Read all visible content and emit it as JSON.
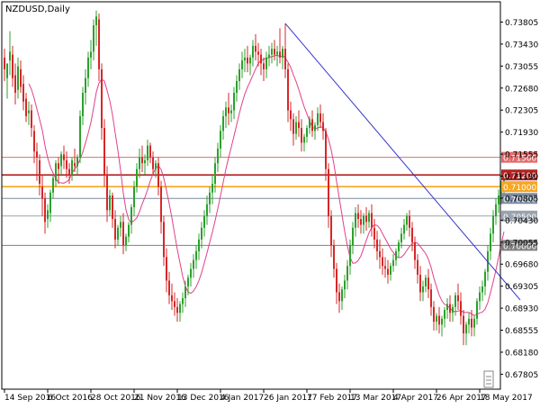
{
  "chart_data": {
    "type": "candlestick",
    "title": "NZDUSD,Daily",
    "price_axis": {
      "ylim": [
        0.6755,
        0.7415
      ],
      "tick_labels": [
        "0.73805",
        "0.73430",
        "0.73055",
        "0.72680",
        "0.72305",
        "0.71930",
        "0.71555",
        "0.71180",
        "0.70805",
        "0.70430",
        "0.70055",
        "0.69680",
        "0.69305",
        "0.68930",
        "0.68555",
        "0.68180",
        "0.67805"
      ]
    },
    "time_axis": {
      "labels": [
        "14 Sep 2016",
        "6 Oct 2016",
        "28 Oct 2016",
        "21 Nov 2016",
        "13 Dec 2016",
        "4 Jan 2017",
        "26 Jan 2017",
        "17 Feb 2017",
        "13 Mar 2017",
        "4 Apr 2017",
        "26 Apr 2017",
        "18 May 2017"
      ],
      "label_bar_index": [
        0,
        16,
        32,
        48,
        64,
        80,
        96,
        112,
        128,
        144,
        160,
        176
      ]
    },
    "horizontal_levels": [
      {
        "value": 0.715,
        "label": "0.71500",
        "color": "#e06b6b"
      },
      {
        "value": 0.712,
        "label": "0.71200",
        "color": "#b22222"
      },
      {
        "value": 0.71,
        "label": "0.71000",
        "color": "#f5a623"
      },
      {
        "value": 0.708,
        "label": "0.70800",
        "color": "#7a8aa0"
      },
      {
        "value": 0.705,
        "label": "0.70500",
        "color": "#9aa3ad"
      },
      {
        "value": 0.7,
        "label": "0.70000",
        "color": "#808080"
      }
    ],
    "trendline": {
      "from": {
        "bar": 104,
        "price": 0.7378
      },
      "to": {
        "bar": 191,
        "price": 0.6907
      },
      "color": "#3333cc"
    },
    "moving_average_color": "#e0408a",
    "bull_color": "#2ca02c",
    "bear_color": "#d62728",
    "candles": [
      [
        0.732,
        0.7335,
        0.73,
        0.728
      ],
      [
        0.7285,
        0.73,
        0.731,
        0.725
      ],
      [
        0.7315,
        0.7365,
        0.733,
        0.729
      ],
      [
        0.7325,
        0.734,
        0.7285,
        0.727
      ],
      [
        0.729,
        0.731,
        0.726,
        0.724
      ],
      [
        0.7265,
        0.732,
        0.7305,
        0.725
      ],
      [
        0.73,
        0.7315,
        0.727,
        0.726
      ],
      [
        0.7275,
        0.729,
        0.7245,
        0.723
      ],
      [
        0.725,
        0.726,
        0.722,
        0.721
      ],
      [
        0.7225,
        0.7245,
        0.723,
        0.7205
      ],
      [
        0.723,
        0.724,
        0.72,
        0.7185
      ],
      [
        0.7195,
        0.7205,
        0.716,
        0.714
      ],
      [
        0.716,
        0.7175,
        0.715,
        0.711
      ],
      [
        0.7145,
        0.7155,
        0.7105,
        0.7085
      ],
      [
        0.71,
        0.712,
        0.708,
        0.705
      ],
      [
        0.708,
        0.709,
        0.704,
        0.702
      ],
      [
        0.7045,
        0.707,
        0.706,
        0.703
      ],
      [
        0.7055,
        0.7095,
        0.709,
        0.704
      ],
      [
        0.709,
        0.712,
        0.7115,
        0.708
      ],
      [
        0.711,
        0.7145,
        0.714,
        0.71
      ],
      [
        0.714,
        0.715,
        0.713,
        0.7105
      ],
      [
        0.7135,
        0.716,
        0.7155,
        0.712
      ],
      [
        0.7155,
        0.717,
        0.7145,
        0.713
      ],
      [
        0.7145,
        0.716,
        0.713,
        0.7115
      ],
      [
        0.713,
        0.714,
        0.712,
        0.7105
      ],
      [
        0.712,
        0.715,
        0.7145,
        0.711
      ],
      [
        0.714,
        0.7165,
        0.7135,
        0.7125
      ],
      [
        0.7135,
        0.7155,
        0.715,
        0.712
      ],
      [
        0.715,
        0.723,
        0.722,
        0.714
      ],
      [
        0.722,
        0.727,
        0.726,
        0.7205
      ],
      [
        0.726,
        0.73,
        0.7285,
        0.724
      ],
      [
        0.7285,
        0.733,
        0.732,
        0.727
      ],
      [
        0.732,
        0.735,
        0.733,
        0.73
      ],
      [
        0.733,
        0.7385,
        0.7375,
        0.7315
      ],
      [
        0.7375,
        0.74,
        0.739,
        0.734
      ],
      [
        0.7385,
        0.7395,
        0.73,
        0.728
      ],
      [
        0.73,
        0.731,
        0.72,
        0.718
      ],
      [
        0.72,
        0.7215,
        0.712,
        0.71
      ],
      [
        0.712,
        0.7135,
        0.706,
        0.704
      ],
      [
        0.706,
        0.7095,
        0.7085,
        0.705
      ],
      [
        0.7085,
        0.709,
        0.7045,
        0.703
      ],
      [
        0.7045,
        0.706,
        0.701,
        0.6995
      ],
      [
        0.701,
        0.7035,
        0.703,
        0.7
      ],
      [
        0.703,
        0.705,
        0.704,
        0.7015
      ],
      [
        0.704,
        0.7055,
        0.7,
        0.6985
      ],
      [
        0.7,
        0.702,
        0.7015,
        0.699
      ],
      [
        0.7015,
        0.704,
        0.7035,
        0.7005
      ],
      [
        0.7035,
        0.707,
        0.7065,
        0.702
      ],
      [
        0.7065,
        0.711,
        0.71,
        0.705
      ],
      [
        0.71,
        0.714,
        0.713,
        0.709
      ],
      [
        0.713,
        0.7165,
        0.715,
        0.7115
      ],
      [
        0.715,
        0.717,
        0.714,
        0.7125
      ],
      [
        0.714,
        0.7155,
        0.7145,
        0.712
      ],
      [
        0.7145,
        0.718,
        0.717,
        0.7135
      ],
      [
        0.717,
        0.7175,
        0.715,
        0.714
      ],
      [
        0.715,
        0.716,
        0.713,
        0.712
      ],
      [
        0.713,
        0.7145,
        0.714,
        0.7115
      ],
      [
        0.714,
        0.715,
        0.71,
        0.7085
      ],
      [
        0.71,
        0.711,
        0.704,
        0.702
      ],
      [
        0.704,
        0.705,
        0.698,
        0.6965
      ],
      [
        0.698,
        0.6995,
        0.694,
        0.692
      ],
      [
        0.694,
        0.6955,
        0.6915,
        0.69
      ],
      [
        0.6915,
        0.6935,
        0.6905,
        0.689
      ],
      [
        0.6905,
        0.692,
        0.6895,
        0.688
      ],
      [
        0.6895,
        0.691,
        0.6885,
        0.687
      ],
      [
        0.6885,
        0.6905,
        0.69,
        0.687
      ],
      [
        0.69,
        0.692,
        0.691,
        0.6885
      ],
      [
        0.691,
        0.694,
        0.693,
        0.6895
      ],
      [
        0.693,
        0.695,
        0.6945,
        0.6915
      ],
      [
        0.6945,
        0.697,
        0.696,
        0.693
      ],
      [
        0.696,
        0.6985,
        0.6975,
        0.6945
      ],
      [
        0.6975,
        0.7,
        0.699,
        0.696
      ],
      [
        0.699,
        0.702,
        0.701,
        0.6975
      ],
      [
        0.701,
        0.704,
        0.703,
        0.6995
      ],
      [
        0.703,
        0.706,
        0.705,
        0.7015
      ],
      [
        0.705,
        0.7085,
        0.707,
        0.7035
      ],
      [
        0.707,
        0.71,
        0.709,
        0.7055
      ],
      [
        0.709,
        0.712,
        0.7105,
        0.707
      ],
      [
        0.7105,
        0.715,
        0.714,
        0.709
      ],
      [
        0.714,
        0.7175,
        0.7165,
        0.7125
      ],
      [
        0.7165,
        0.7205,
        0.7195,
        0.715
      ],
      [
        0.7195,
        0.723,
        0.722,
        0.718
      ],
      [
        0.722,
        0.7245,
        0.7235,
        0.72
      ],
      [
        0.7235,
        0.726,
        0.7225,
        0.7205
      ],
      [
        0.7225,
        0.724,
        0.723,
        0.721
      ],
      [
        0.723,
        0.727,
        0.726,
        0.7215
      ],
      [
        0.726,
        0.729,
        0.728,
        0.7245
      ],
      [
        0.728,
        0.731,
        0.73,
        0.7265
      ],
      [
        0.73,
        0.733,
        0.7315,
        0.7285
      ],
      [
        0.7315,
        0.7335,
        0.732,
        0.7295
      ],
      [
        0.732,
        0.734,
        0.731,
        0.7295
      ],
      [
        0.731,
        0.7325,
        0.732,
        0.729
      ],
      [
        0.732,
        0.735,
        0.734,
        0.7305
      ],
      [
        0.734,
        0.736,
        0.733,
        0.7315
      ],
      [
        0.733,
        0.7345,
        0.7325,
        0.7305
      ],
      [
        0.7325,
        0.7335,
        0.731,
        0.729
      ],
      [
        0.731,
        0.732,
        0.73,
        0.728
      ],
      [
        0.73,
        0.733,
        0.732,
        0.7285
      ],
      [
        0.732,
        0.734,
        0.7325,
        0.7305
      ],
      [
        0.7325,
        0.7345,
        0.7335,
        0.731
      ],
      [
        0.7335,
        0.735,
        0.7325,
        0.7315
      ],
      [
        0.7325,
        0.734,
        0.733,
        0.7305
      ],
      [
        0.733,
        0.737,
        0.732,
        0.731
      ],
      [
        0.732,
        0.734,
        0.7335,
        0.73
      ],
      [
        0.7335,
        0.7378,
        0.73,
        0.7285
      ],
      [
        0.73,
        0.731,
        0.723,
        0.721
      ],
      [
        0.723,
        0.7245,
        0.7215,
        0.7195
      ],
      [
        0.7215,
        0.7225,
        0.719,
        0.717
      ],
      [
        0.719,
        0.722,
        0.721,
        0.718
      ],
      [
        0.721,
        0.723,
        0.72,
        0.7185
      ],
      [
        0.72,
        0.7215,
        0.7175,
        0.716
      ],
      [
        0.7175,
        0.719,
        0.7185,
        0.716
      ],
      [
        0.7185,
        0.7205,
        0.72,
        0.7175
      ],
      [
        0.72,
        0.722,
        0.7215,
        0.719
      ],
      [
        0.7215,
        0.723,
        0.7195,
        0.7185
      ],
      [
        0.7195,
        0.721,
        0.7205,
        0.718
      ],
      [
        0.7205,
        0.7235,
        0.7225,
        0.7195
      ],
      [
        0.7225,
        0.724,
        0.721,
        0.72
      ],
      [
        0.721,
        0.7225,
        0.7195,
        0.718
      ],
      [
        0.7195,
        0.72,
        0.713,
        0.711
      ],
      [
        0.713,
        0.714,
        0.705,
        0.703
      ],
      [
        0.705,
        0.706,
        0.7,
        0.698
      ],
      [
        0.7,
        0.701,
        0.696,
        0.6945
      ],
      [
        0.696,
        0.697,
        0.692,
        0.69
      ],
      [
        0.692,
        0.6935,
        0.6905,
        0.6885
      ],
      [
        0.6905,
        0.693,
        0.6925,
        0.689
      ],
      [
        0.6925,
        0.695,
        0.694,
        0.691
      ],
      [
        0.694,
        0.6975,
        0.6965,
        0.6925
      ],
      [
        0.6965,
        0.701,
        0.7,
        0.695
      ],
      [
        0.7,
        0.704,
        0.703,
        0.6985
      ],
      [
        0.703,
        0.7065,
        0.7055,
        0.7015
      ],
      [
        0.7055,
        0.707,
        0.7045,
        0.703
      ],
      [
        0.7045,
        0.706,
        0.7035,
        0.702
      ],
      [
        0.7035,
        0.7055,
        0.705,
        0.702
      ],
      [
        0.705,
        0.7065,
        0.704,
        0.7025
      ],
      [
        0.704,
        0.706,
        0.7055,
        0.703
      ],
      [
        0.7055,
        0.707,
        0.703,
        0.7015
      ],
      [
        0.703,
        0.7045,
        0.701,
        0.6995
      ],
      [
        0.701,
        0.7025,
        0.699,
        0.6975
      ],
      [
        0.699,
        0.701,
        0.698,
        0.696
      ],
      [
        0.698,
        0.6995,
        0.6965,
        0.695
      ],
      [
        0.6965,
        0.698,
        0.696,
        0.6945
      ],
      [
        0.696,
        0.6975,
        0.695,
        0.6935
      ],
      [
        0.695,
        0.697,
        0.6965,
        0.694
      ],
      [
        0.6965,
        0.6985,
        0.6975,
        0.6955
      ],
      [
        0.6975,
        0.6995,
        0.699,
        0.6965
      ],
      [
        0.699,
        0.701,
        0.7005,
        0.698
      ],
      [
        0.7005,
        0.703,
        0.702,
        0.6995
      ],
      [
        0.702,
        0.7045,
        0.7035,
        0.701
      ],
      [
        0.7035,
        0.7055,
        0.705,
        0.7025
      ],
      [
        0.705,
        0.706,
        0.703,
        0.7015
      ],
      [
        0.703,
        0.704,
        0.7005,
        0.699
      ],
      [
        0.7005,
        0.7015,
        0.6975,
        0.696
      ],
      [
        0.6975,
        0.6985,
        0.695,
        0.6935
      ],
      [
        0.695,
        0.6965,
        0.692,
        0.6905
      ],
      [
        0.692,
        0.694,
        0.693,
        0.6905
      ],
      [
        0.693,
        0.695,
        0.6945,
        0.692
      ],
      [
        0.6945,
        0.696,
        0.6925,
        0.691
      ],
      [
        0.6925,
        0.6935,
        0.6895,
        0.688
      ],
      [
        0.6895,
        0.6905,
        0.687,
        0.6855
      ],
      [
        0.687,
        0.6885,
        0.688,
        0.6855
      ],
      [
        0.688,
        0.6895,
        0.6865,
        0.685
      ],
      [
        0.6865,
        0.688,
        0.6875,
        0.6845
      ],
      [
        0.6875,
        0.6895,
        0.689,
        0.686
      ],
      [
        0.689,
        0.691,
        0.69,
        0.6875
      ],
      [
        0.69,
        0.6915,
        0.6885,
        0.687
      ],
      [
        0.6885,
        0.69,
        0.6895,
        0.687
      ],
      [
        0.6895,
        0.692,
        0.6915,
        0.688
      ],
      [
        0.6915,
        0.6935,
        0.6905,
        0.689
      ],
      [
        0.6905,
        0.692,
        0.688,
        0.6865
      ],
      [
        0.688,
        0.689,
        0.685,
        0.683
      ],
      [
        0.685,
        0.687,
        0.6865,
        0.683
      ],
      [
        0.6865,
        0.6885,
        0.6875,
        0.685
      ],
      [
        0.6875,
        0.689,
        0.686,
        0.6845
      ],
      [
        0.686,
        0.688,
        0.6875,
        0.6845
      ],
      [
        0.6875,
        0.691,
        0.6905,
        0.6865
      ],
      [
        0.6905,
        0.693,
        0.692,
        0.689
      ],
      [
        0.692,
        0.694,
        0.693,
        0.6905
      ],
      [
        0.693,
        0.696,
        0.6955,
        0.6915
      ],
      [
        0.6955,
        0.7,
        0.699,
        0.694
      ],
      [
        0.699,
        0.703,
        0.702,
        0.6975
      ],
      [
        0.702,
        0.706,
        0.705,
        0.7005
      ],
      [
        0.705,
        0.708,
        0.707,
        0.7035
      ],
      [
        0.707,
        0.7095,
        0.7085,
        0.7055
      ],
      [
        0.7085,
        0.711,
        0.71,
        0.707
      ],
      [
        0.71,
        0.7125,
        0.7115,
        0.708
      ]
    ]
  }
}
